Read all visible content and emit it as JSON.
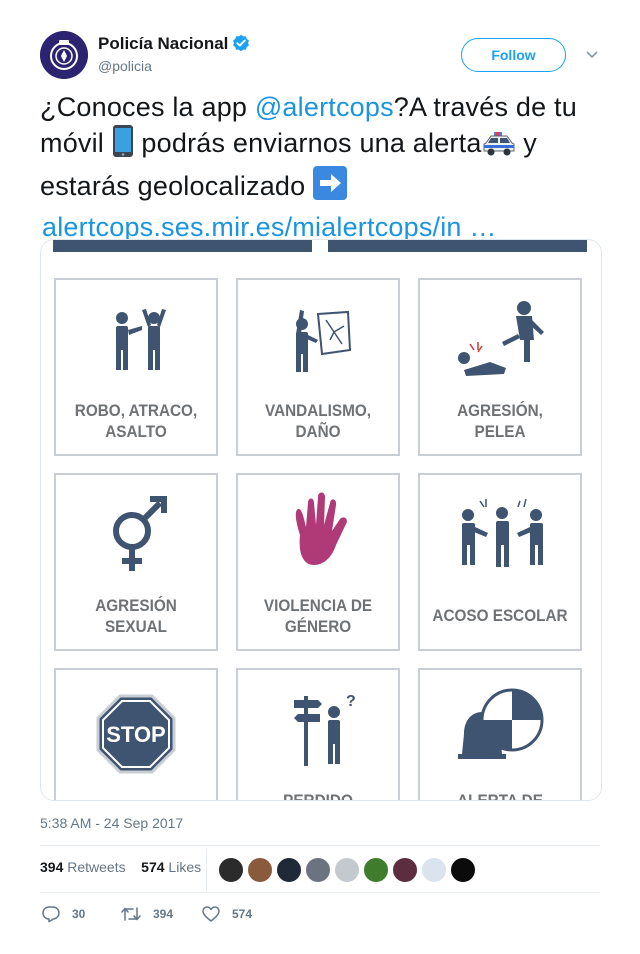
{
  "account": {
    "name": "Policía Nacional",
    "handle": "@policia",
    "follow_label": "Follow"
  },
  "tweet": {
    "text_1": "¿Conoces la app ",
    "mention": "@alertcops",
    "text_2": "?A través de tu móvil ",
    "text_3": " podrás enviarnos una alerta",
    "text_4": " y estarás geolocalizado ",
    "link": "alertcops.ses.mir.es/mialertcops/in …"
  },
  "media": {
    "tiles": [
      {
        "line1": "ROBO, ATRACO,",
        "line2": "ASALTO"
      },
      {
        "line1": "VANDALISMO,",
        "line2": "DAÑO"
      },
      {
        "line1": "AGRESIÓN,",
        "line2": "PELEA"
      },
      {
        "line1": "AGRESIÓN",
        "line2": "SEXUAL"
      },
      {
        "line1": "VIOLENCIA DE",
        "line2": "GÉNERO"
      },
      {
        "line1": "ACOSO ESCOLAR",
        "line2": ""
      },
      {
        "line1": "STOP",
        "line2": ""
      },
      {
        "line1": "PERDIDO",
        "line2": ""
      },
      {
        "line1": "ALERTA DE",
        "line2": ""
      }
    ]
  },
  "timestamp": "5:38 AM - 24 Sep 2017",
  "stats": {
    "retweets_count": "394",
    "retweets_label": "Retweets",
    "likes_count": "574",
    "likes_label": "Likes"
  },
  "actions": {
    "reply_count": "30",
    "retweet_count": "394",
    "like_count": "574"
  },
  "colors": {
    "link": "#1b95e0",
    "follow": "#1da1f2",
    "icon_navy": "#3f5470",
    "icon_magenta": "#b03a78"
  },
  "icons": [
    "verified-badge-icon",
    "chevron-down-icon",
    "mobile-phone-emoji-icon",
    "police-car-emoji-icon",
    "right-arrow-emoji-icon",
    "reply-icon",
    "retweet-icon",
    "like-icon"
  ]
}
